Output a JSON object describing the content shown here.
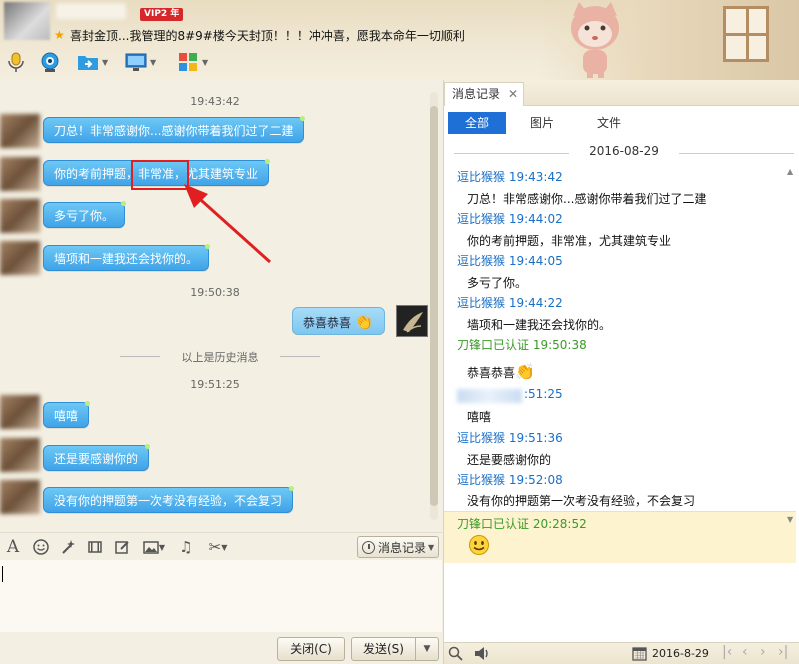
{
  "header": {
    "vip_badge": "VIP2 年",
    "signature": "喜封金顶...我管理的8#9#楼今天封顶！！！冲冲喜，愿我本命年一切顺利"
  },
  "chat": {
    "messages": [
      {
        "time": "19:43:42"
      },
      {
        "text": "刀总！非常感谢你...感谢你带着我们过了二建"
      },
      {
        "text_prefix": "你的考前押题，",
        "text_highlight": "非常准",
        "text_suffix": "，尤其建筑专业"
      },
      {
        "text": "多亏了你。"
      },
      {
        "text": "墙项和一建我还会找你的。"
      },
      {
        "time": "19:50:38"
      },
      {
        "text": "恭喜恭喜"
      },
      {
        "divider": "以上是历史消息"
      },
      {
        "time": "19:51:25"
      },
      {
        "text": "嘻嘻"
      },
      {
        "text": "还是要感谢你的"
      },
      {
        "text": "没有你的押题第一次考没有经验，不会复习"
      }
    ]
  },
  "input_toolbar": {
    "history_button": "消息记录"
  },
  "buttons": {
    "close": "关闭(C)",
    "send": "发送(S)"
  },
  "history_panel": {
    "tab_title": "消息记录",
    "filters": [
      "全部",
      "图片",
      "文件"
    ],
    "date": "2016-08-29",
    "entries": [
      {
        "sender": "逗比猴猴 19:43:42",
        "text": "刀总！非常感谢你...感谢你带着我们过了二建"
      },
      {
        "sender": "逗比猴猴 19:44:02",
        "text": "你的考前押题，非常准，尤其建筑专业"
      },
      {
        "sender": "逗比猴猴 19:44:05",
        "text": "多亏了你。"
      },
      {
        "sender": "逗比猴猴 19:44:22",
        "text": "墙项和一建我还会找你的。"
      },
      {
        "sender": "刀锋口已认证 19:50:38",
        "text": "恭喜恭喜"
      },
      {
        "sender": ":51:25",
        "text": "嘻嘻"
      },
      {
        "sender": "逗比猴猴 19:51:36",
        "text": "还是要感谢你的"
      },
      {
        "sender": "逗比猴猴 19:52:08",
        "text": "没有你的押题第一次考没有经验，不会复习"
      },
      {
        "sender": "刀锋口已认证 20:28:52"
      }
    ],
    "footer_date": "2016-8-29"
  },
  "colors": {
    "bubble_blue": "#3fa3e8",
    "active_filter": "#1e6fd6",
    "sender_blue": "#1a6fc7",
    "sender_green": "#3a9a28",
    "annotation_red": "#e02020"
  },
  "icons": [
    "microphone-icon",
    "webcam-icon",
    "file-transfer-icon",
    "screen-share-icon",
    "apps-icon",
    "font-icon",
    "emoji-icon",
    "magic-icon",
    "video-icon",
    "edit-icon",
    "image-icon",
    "music-icon",
    "scissors-icon",
    "clock-icon",
    "search-icon",
    "speaker-icon",
    "calendar-icon"
  ]
}
